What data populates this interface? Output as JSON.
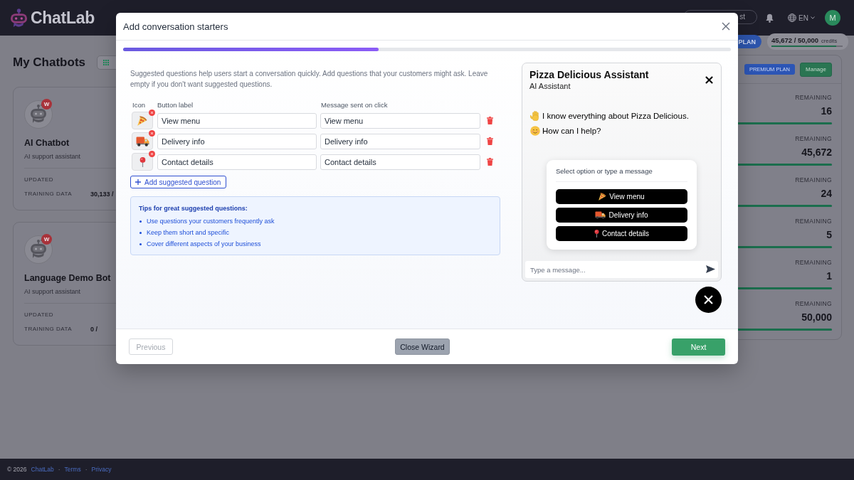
{
  "header": {
    "logo_text": "ChatLab",
    "button_label": "st",
    "language": "EN",
    "avatar_initial": "M"
  },
  "plan_badge": "PLAN",
  "credits": {
    "value": "45,672 / 50,000",
    "unit": "credits",
    "level": 0.91
  },
  "page_title": "My Chatbots",
  "chatbots": [
    {
      "name": "AI Chatbot",
      "description": "AI support assistant",
      "badge": "W",
      "updated_label": "UPDATED",
      "training_label": "TRAINING DATA",
      "training_value": "30,133 /"
    },
    {
      "name": "Language Demo Bot",
      "description": "AI support assistant",
      "badge": "W",
      "updated_label": "UPDATED",
      "training_label": "TRAINING DATA",
      "training_value": "0 /"
    }
  ],
  "usage_panel": {
    "plan_badge": "PREMIUM PLAN",
    "manage_button": "Manage",
    "rows": [
      {
        "label": "REMAINING",
        "value": "16",
        "level": 1
      },
      {
        "label": "REMAINING",
        "value": "45,672",
        "level": 1
      },
      {
        "label": "REMAINING",
        "value": "24",
        "level": 1
      },
      {
        "label": "REMAINING",
        "value": "5",
        "level": 1
      },
      {
        "label": "REMAINING",
        "value": "1",
        "level": 1
      },
      {
        "label": "REMAINING",
        "value": "50,000",
        "level": 1
      }
    ]
  },
  "modal": {
    "title": "Add conversation starters",
    "progress": {
      "level": 0.42
    },
    "description": "Suggested questions help users start a conversation quickly. Add questions that your customers might ask. Leave empty if you don't want suggested questions.",
    "columns": [
      "Icon",
      "Button label",
      "Message sent on click"
    ],
    "questions": [
      {
        "kind": "pizza",
        "label": "View menu",
        "message": "View menu"
      },
      {
        "kind": "truck",
        "label": "Delivery info",
        "message": "Delivery info"
      },
      {
        "kind": "pin",
        "label": "Contact details",
        "message": "Contact details"
      }
    ],
    "add_button": "Add suggested question",
    "tips": {
      "title": "Tips for great suggested questions:",
      "items": [
        "Use questions your customers frequently ask",
        "Keep them short and specific",
        "Cover different aspects of your business"
      ]
    },
    "preview": {
      "title": "Pizza Delicious Assistant",
      "subtitle": "AI Assistant",
      "messages": [
        {
          "kind": "wave",
          "text": "I know everything about Pizza Delicious."
        },
        {
          "kind": "smile",
          "text": "How can I help?"
        }
      ],
      "quick_replies": {
        "prompt": "Select option or type a message",
        "options": [
          {
            "kind": "pizza",
            "label": "View menu"
          },
          {
            "kind": "truck",
            "label": "Delivery info"
          },
          {
            "kind": "pin",
            "label": "Contact details"
          }
        ]
      },
      "input": {
        "placeholder": "Type a message..."
      }
    },
    "footer": {
      "previous": {
        "label": "Previous",
        "disabled": true
      },
      "close": "Close Wizard",
      "next": "Next"
    }
  },
  "footer": {
    "items": [
      {
        "kind": "text",
        "text": "© 2026"
      },
      {
        "kind": "link",
        "text": "ChatLab"
      },
      {
        "kind": "separator",
        "text": "·"
      },
      {
        "kind": "link",
        "text": "Terms"
      },
      {
        "kind": "separator",
        "text": "·"
      },
      {
        "kind": "link",
        "text": "Privacy"
      }
    ]
  }
}
